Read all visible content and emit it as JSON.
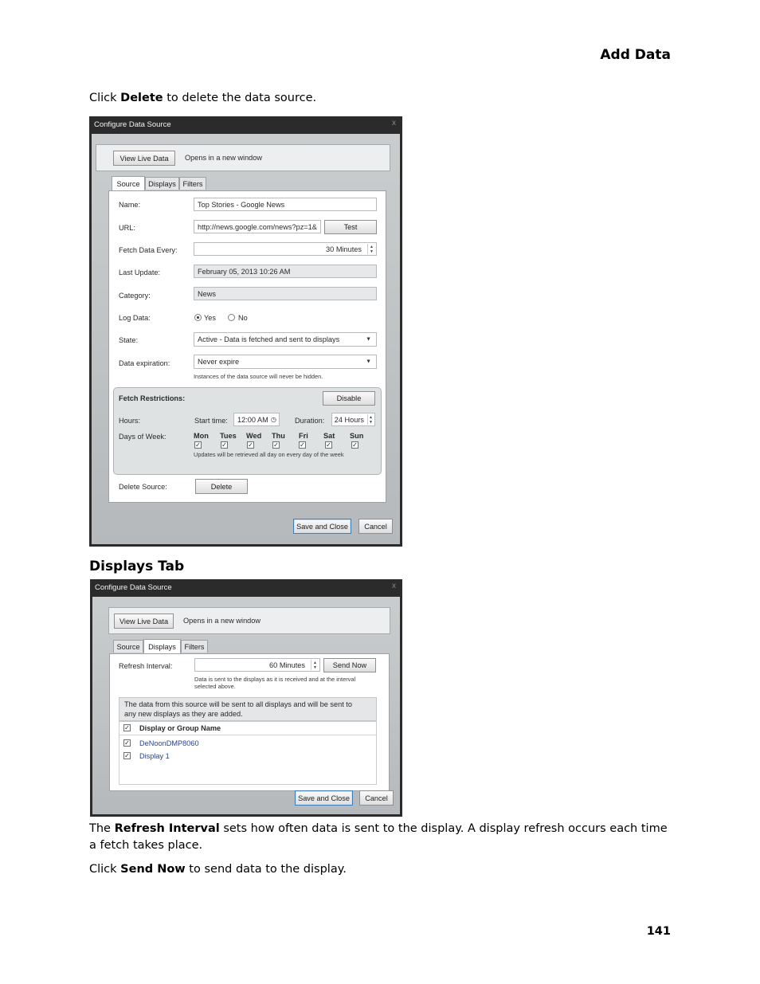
{
  "header": {
    "title": "Add Data"
  },
  "intro": {
    "pre": "Click ",
    "bold": "Delete",
    "post": " to delete the data source."
  },
  "dialog1": {
    "title": "Configure Data Source",
    "close_glyph": "x",
    "view_live_label": "View Live Data",
    "opens_note": "Opens in a new window",
    "tabs": [
      "Source",
      "Displays",
      "Filters"
    ],
    "name_label": "Name:",
    "name_value": "Top Stories - Google News",
    "url_label": "URL:",
    "url_value": "http://news.google.com/news?pz=1&",
    "test_label": "Test",
    "fetch_label": "Fetch Data Every:",
    "fetch_value": "30 Minutes",
    "last_update_label": "Last Update:",
    "last_update_value": "February 05, 2013 10:26 AM",
    "category_label": "Category:",
    "category_value": "News",
    "log_label": "Log Data:",
    "log_yes": "Yes",
    "log_no": "No",
    "state_label": "State:",
    "state_value": "Active - Data is fetched and sent to displays",
    "expiration_label": "Data expiration:",
    "expiration_value": "Never expire",
    "expiration_note": "Instances of the data source will  never  be hidden.",
    "restrictions_label": "Fetch Restrictions:",
    "disable_label": "Disable",
    "hours_label": "Hours:",
    "start_time_label": "Start time:",
    "start_time_value": "12:00 AM",
    "duration_label": "Duration:",
    "duration_value": "24 Hours",
    "days_label": "Days of Week:",
    "days": [
      "Mon",
      "Tues",
      "Wed",
      "Thu",
      "Fri",
      "Sat",
      "Sun"
    ],
    "days_checked_glyph": "✓",
    "days_note": "Updates will be retrieved  all day  on  every day   of the week",
    "delete_source_label": "Delete Source:",
    "delete_label": "Delete",
    "save_close_label": "Save and Close",
    "cancel_label": "Cancel"
  },
  "displays_heading": "Displays Tab",
  "dialog2": {
    "title": "Configure Data Source",
    "close_glyph": "x",
    "view_live_label": "View Live Data",
    "opens_note": "Opens in a new window",
    "tabs": [
      "Source",
      "Displays",
      "Filters"
    ],
    "refresh_label": "Refresh Interval:",
    "refresh_value": "60 Minutes",
    "send_now_label": "Send Now",
    "refresh_note_1": "Data is sent to the displays as it is received and at the interval",
    "refresh_note_2": "selected above.",
    "info_line_1": "The data from this source will be sent to all displays and will be sent to",
    "info_line_2": "any new displays as they are added.",
    "table_header": "Display or Group Name",
    "rows": [
      "DeNoonDMP8060",
      "Display 1"
    ],
    "check_glyph": "✓",
    "save_close_label": "Save and Close",
    "cancel_label": "Cancel"
  },
  "para1": {
    "pre": "The ",
    "bold": "Refresh Interval",
    "post": " sets how often data is sent to the display. A display refresh occurs each time a fetch takes place."
  },
  "para2": {
    "pre": "Click ",
    "bold": "Send Now",
    "post": " to send data to the display."
  },
  "page_number": "141"
}
